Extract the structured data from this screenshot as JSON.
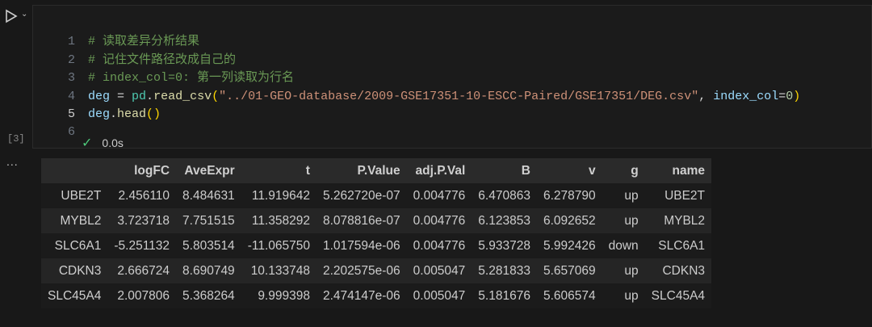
{
  "cell": {
    "execution_count": "[3]",
    "status_time": "0.0s",
    "lines": [
      {
        "n": "1",
        "comment": "# 读取差异分析结果"
      },
      {
        "n": "2",
        "comment": "# 记住文件路径改成自己的"
      },
      {
        "n": "3",
        "comment": "# index_col=0: 第一列读取为行名"
      },
      {
        "n": "4",
        "var": "deg",
        "eq": " = ",
        "mod": "pd",
        "dot": ".",
        "fn": "read_csv",
        "open": "(",
        "str": "\"../01-GEO-database/2009-GSE17351-10-ESCC-Paired/GSE17351/DEG.csv\"",
        "comma": ", ",
        "kw": "index_col",
        "kweq": "=",
        "num": "0",
        "close": ")"
      },
      {
        "n": "5",
        "var": "deg",
        "dot": ".",
        "fn": "head",
        "parens": "()"
      },
      {
        "n": "6"
      }
    ]
  },
  "output": {
    "ellipsis": "...",
    "columns": [
      "",
      "logFC",
      "AveExpr",
      "t",
      "P.Value",
      "adj.P.Val",
      "B",
      "v",
      "g",
      "name"
    ],
    "rows": [
      [
        "UBE2T",
        "2.456110",
        "8.484631",
        "11.919642",
        "5.262720e-07",
        "0.004776",
        "6.470863",
        "6.278790",
        "up",
        "UBE2T"
      ],
      [
        "MYBL2",
        "3.723718",
        "7.751515",
        "11.358292",
        "8.078816e-07",
        "0.004776",
        "6.123853",
        "6.092652",
        "up",
        "MYBL2"
      ],
      [
        "SLC6A1",
        "-5.251132",
        "5.803514",
        "-11.065750",
        "1.017594e-06",
        "0.004776",
        "5.933728",
        "5.992426",
        "down",
        "SLC6A1"
      ],
      [
        "CDKN3",
        "2.666724",
        "8.690749",
        "10.133748",
        "2.202575e-06",
        "0.005047",
        "5.281833",
        "5.657069",
        "up",
        "CDKN3"
      ],
      [
        "SLC45A4",
        "2.007806",
        "5.368264",
        "9.999398",
        "2.474147e-06",
        "0.005047",
        "5.181676",
        "5.606574",
        "up",
        "SLC45A4"
      ]
    ]
  }
}
